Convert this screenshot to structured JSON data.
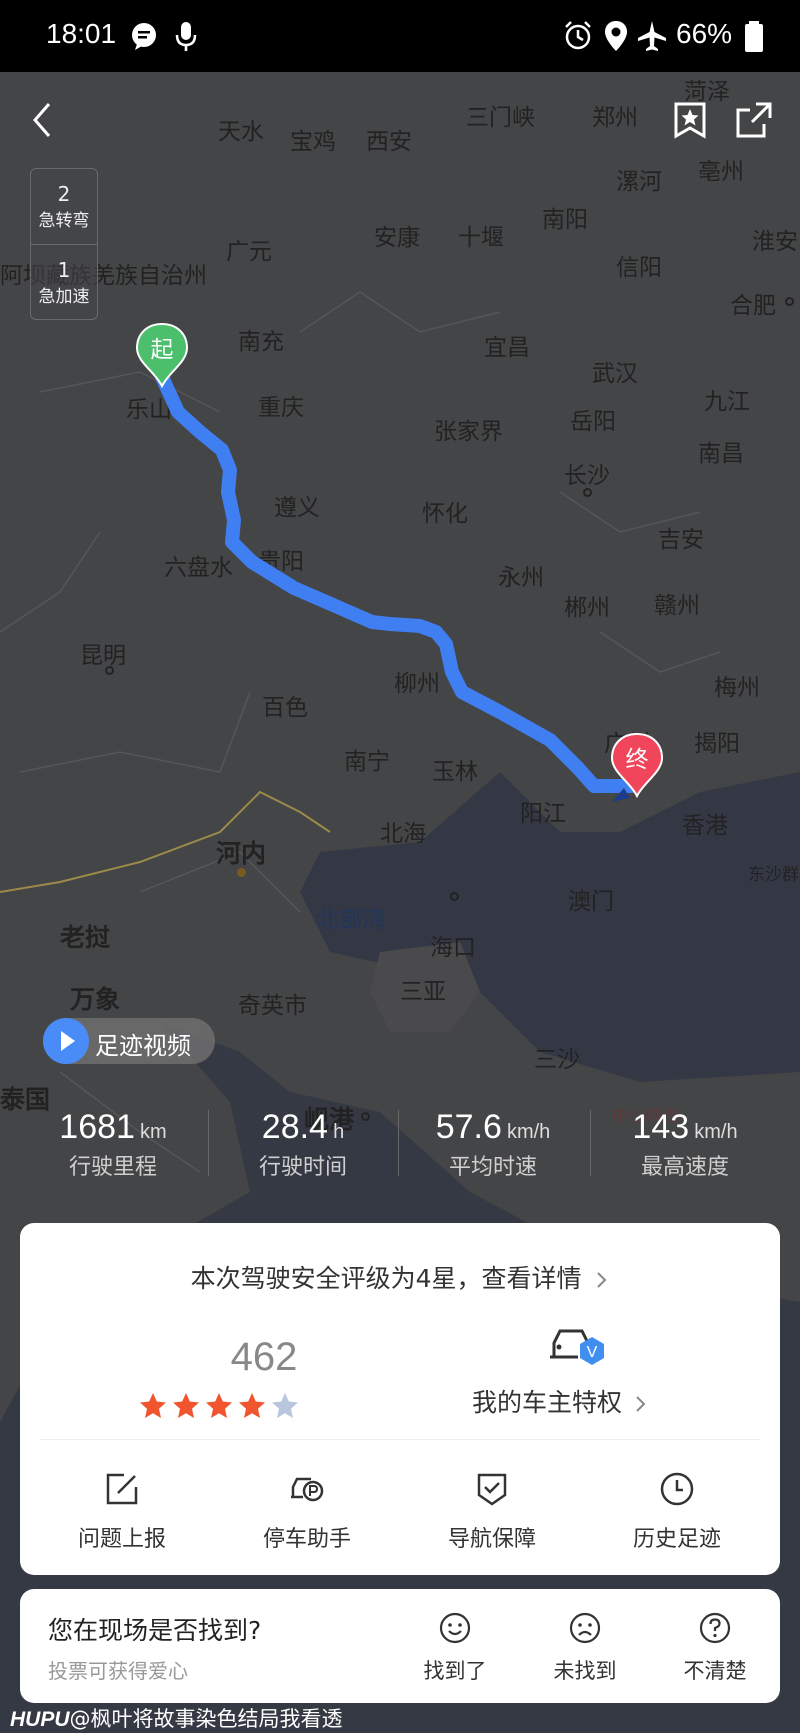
{
  "status_bar": {
    "time": "18:01",
    "battery": "66%",
    "icons": [
      "message-icon",
      "mic-icon",
      "alarm-icon",
      "location-icon",
      "airplane-icon",
      "battery-icon"
    ]
  },
  "top_bar": {
    "back_icon": "back-icon",
    "favorite_icon": "star-bookmark-icon",
    "share_icon": "share-icon"
  },
  "events": [
    {
      "count": "2",
      "label": "急转弯"
    },
    {
      "count": "1",
      "label": "急加速"
    }
  ],
  "map": {
    "start_label": "起",
    "end_label": "终",
    "labels": {
      "tianshui": "天水",
      "baoji": "宝鸡",
      "xian": "西安",
      "sanmenxia": "三门峡",
      "zhengzhou": "郑州",
      "heze": "菏泽",
      "bozhou": "亳州",
      "guangyuan": "广元",
      "ankang": "安康",
      "shiyan": "十堰",
      "nanyang": "南阳",
      "luohe": "漯河",
      "huaiyu": "淮安",
      "aba": "阿坝藏族羌族自治州",
      "xinyang": "信阳",
      "hefei": "合肥",
      "nanchong": "南充",
      "yichang": "宜昌",
      "wuhan": "武汉",
      "jiujiang": "九江",
      "leshan": "乐山",
      "chongqing": "重庆",
      "zhangjiajie": "张家界",
      "yueyang": "岳阳",
      "nanchang": "南昌",
      "changsha": "长沙",
      "zunyi": "遵义",
      "huaihua": "怀化",
      "jian": "吉安",
      "liupanshui": "六盘水",
      "guiyang": "贵阳",
      "yongzhou": "永州",
      "chenzhou": "郴州",
      "ganzhou": "赣州",
      "kunming": "昆明",
      "liuzhou": "柳州",
      "meizhou": "梅州",
      "baise": "百色",
      "guangzhou": "广州",
      "jieyang": "揭阳",
      "nanning": "南宁",
      "yulin": "玉林",
      "yangjiang": "阳江",
      "xianggang": "香港",
      "hanoi": "河内",
      "beihai": "北海",
      "dongsha": "东沙群",
      "aomen": "澳门",
      "beibuwan": "北部湾",
      "laojie": "老挝",
      "haikou": "海口",
      "wanxiang": "万象",
      "qiying": "奇英市",
      "sanya": "三亚",
      "sansha": "三沙",
      "taiguo": "泰国",
      "xian_gang": "岘港",
      "zhongsha": "中沙群岛"
    }
  },
  "video_button": {
    "label": "足迹视频"
  },
  "stats": [
    {
      "value": "1681",
      "unit": "km",
      "label": "行驶里程"
    },
    {
      "value": "28.4",
      "unit": "h",
      "label": "行驶时间"
    },
    {
      "value": "57.6",
      "unit": "km/h",
      "label": "平均时速"
    },
    {
      "value": "143",
      "unit": "km/h",
      "label": "最高速度"
    }
  ],
  "card": {
    "rating_text": "本次驾驶安全评级为4星，查看详情",
    "score": "462",
    "stars": 4,
    "stars_total": 5,
    "privilege": "我的车主特权",
    "badge": "V",
    "tools": [
      {
        "label": "问题上报",
        "icon": "edit-report-icon"
      },
      {
        "label": "停车助手",
        "icon": "parking-car-icon"
      },
      {
        "label": "导航保障",
        "icon": "shield-check-icon"
      },
      {
        "label": "历史足迹",
        "icon": "clock-icon"
      }
    ]
  },
  "feedback": {
    "question": "您在现场是否找到?",
    "subtext": "投票可获得爱心",
    "options": [
      {
        "label": "找到了",
        "icon": "smile-icon"
      },
      {
        "label": "未找到",
        "icon": "frown-icon"
      },
      {
        "label": "不清楚",
        "icon": "question-icon"
      }
    ]
  },
  "watermark": {
    "brand": "HUPU",
    "text": "@枫叶将故事染色结局我看透"
  },
  "colors": {
    "route": "#3f7ff2",
    "start_pin": "#4bbf6b",
    "end_pin": "#f0455a",
    "star_on": "#f0552f",
    "star_off": "#b9c6de",
    "badge": "#3f8ef0"
  }
}
